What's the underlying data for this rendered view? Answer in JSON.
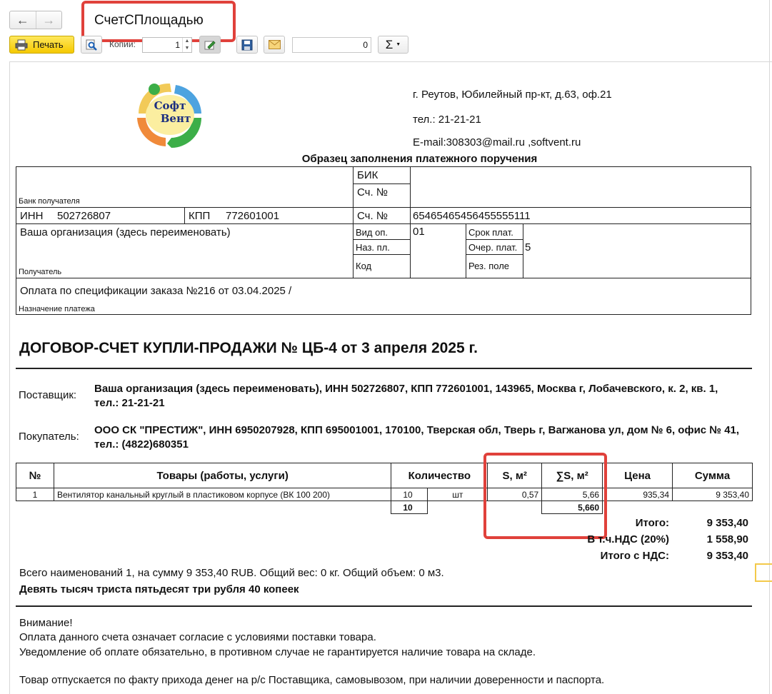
{
  "window": {
    "title": "СчетСПлощадью",
    "back_icon": "←",
    "forward_icon": "→"
  },
  "toolbar": {
    "print_label": "Печать",
    "copies_label": "Копии:",
    "copies_value": "1",
    "sum_value": "0",
    "sigma_label": "Σ"
  },
  "supplier_header": {
    "logo_text_line1": "Софт",
    "logo_text_line2": "Вент",
    "address": "г. Реутов, Юбилейный пр-кт, д.63, оф.21",
    "phone": "тел.: 21-21-21",
    "email": "E-mail:308303@mail.ru ,softvent.ru"
  },
  "payment_form": {
    "title": "Образец заполнения платежного поручения",
    "bank_label": "Банк получателя",
    "bik_label": "БИК",
    "account_label_1": "Сч. №",
    "inn_label": "ИНН",
    "inn_value": "502726807",
    "kpp_label": "КПП",
    "kpp_value": "772601001",
    "account_label_2": "Сч. №",
    "account_value": "65465465456455555111",
    "recipient_name": "Ваша организация (здесь переименовать)",
    "recipient_label": "Получатель",
    "op_type_label": "Вид оп.",
    "op_type_value": "01",
    "purpose_code_label": "Наз. пл.",
    "code_label": "Код",
    "term_label": "Срок плат.",
    "order_label": "Очер. плат.",
    "order_value": "5",
    "reserve_label": "Рез. поле",
    "purpose_value": "Оплата по спецификации заказа №216 от 03.04.2025 /",
    "purpose_label": "Назначение платежа"
  },
  "contract": {
    "title": "ДОГОВОР-СЧЕТ КУПЛИ-ПРОДАЖИ № ЦБ-4 от 3 апреля 2025 г.",
    "supplier_label": "Поставщик:",
    "supplier_value": "Ваша организация (здесь переименовать), ИНН 502726807, КПП 772601001, 143965, Москва г, Лобачевского, к. 2, кв. 1, тел.: 21-21-21",
    "buyer_label": "Покупатель:",
    "buyer_value": "ООО СК \"ПРЕСТИЖ\", ИНН 6950207928, КПП 695001001, 170100, Тверская обл, Тверь г, Вагжанова ул, дом № 6, офис № 41, тел.: (4822)680351"
  },
  "items_table": {
    "headers": [
      "№",
      "Товары (работы, услуги)",
      "Количество",
      "S, м²",
      "∑S, м²",
      "Цена",
      "Сумма"
    ],
    "rows": [
      {
        "num": "1",
        "name": "Вентилятор канальный круглый в пластиковом корпусе (ВК 100 200)",
        "qty": "10",
        "unit": "шт",
        "area": "0,57",
        "total_area": "5,66",
        "price": "935,34",
        "sum": "9 353,40"
      }
    ],
    "total_qty": "10",
    "total_area": "5,660"
  },
  "totals": {
    "total_label": "Итого:",
    "total_value": "9 353,40",
    "vat_label": "В т.ч.НДС (20%)",
    "vat_value": "1 558,90",
    "total_vat_label": "Итого с НДС:",
    "total_vat_value": "9 353,40"
  },
  "summary": {
    "line": "Всего наименований 1, на сумму 9 353,40 RUB. Общий вес: 0 кг. Общий объем: 0 м3.",
    "in_words": "Девять тысяч триста пятьдесят три рубля 40 копеек"
  },
  "notes": {
    "attention": "Внимание!",
    "line1": "Оплата данного счета означает согласие с условиями поставки товара.",
    "line2": "Уведомление об оплате обязательно, в противном случае не гарантируется наличие товара на складе.",
    "line3": "Товар отпускается по факту прихода денег на р/с Поставщика, самовывозом, при наличии доверенности и паспорта."
  }
}
